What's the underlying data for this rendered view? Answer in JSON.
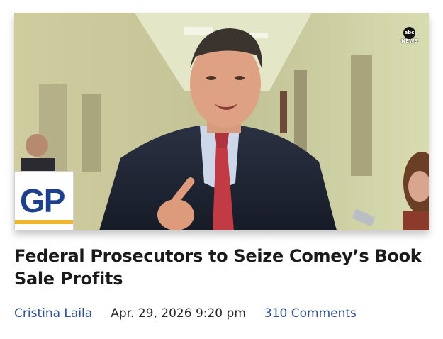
{
  "article": {
    "headline": "Federal Prosecutors to Seize Comey’s Book Sale Profits",
    "author": "Cristina Laila",
    "date": "Apr. 29, 2026 9:20 pm",
    "comments": "310 Comments"
  },
  "logos": {
    "site_logo_text": "GP",
    "watermark_text": "abc",
    "watermark_subtext": "NEWS"
  },
  "colors": {
    "link": "#2d4f9a",
    "headline": "#1a1a1a",
    "brand_blue": "#1d3f8f",
    "brand_gold": "#f0b52a"
  }
}
